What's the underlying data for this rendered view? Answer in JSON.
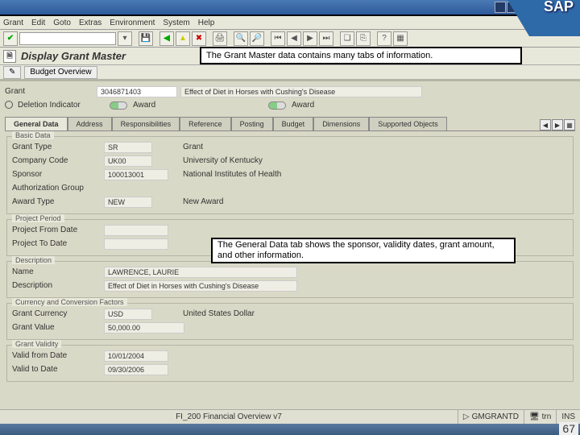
{
  "menubar": [
    "Grant",
    "Edit",
    "Goto",
    "Extras",
    "Environment",
    "System",
    "Help"
  ],
  "header": {
    "title": "Display Grant Master",
    "app_button": "Budget Overview"
  },
  "callouts": {
    "top": "The Grant Master data contains many tabs of information.",
    "mid": "The General Data tab shows the sponsor, validity dates, grant amount, and other information."
  },
  "grant_line": {
    "grant_label": "Grant",
    "grant_value": "3046871403",
    "grant_name": "Effect of Diet in Horses with Cushing's Disease"
  },
  "indicators": {
    "del_label": "Deletion Indicator",
    "award1": "Award",
    "award2": "Award"
  },
  "tabs": [
    "General Data",
    "Address",
    "Responsibilities",
    "Reference",
    "Posting",
    "Budget",
    "Dimensions",
    "Supported Objects"
  ],
  "basic": {
    "title": "Basic Data",
    "grant_type_l": "Grant Type",
    "grant_type_v": "SR",
    "grant_type_t": "Grant",
    "company_l": "Company Code",
    "company_v": "UK00",
    "company_t": "University of Kentucky",
    "sponsor_l": "Sponsor",
    "sponsor_v": "100013001",
    "sponsor_t": "National Institutes of Health",
    "authgrp_l": "Authorization Group",
    "award_l": "Award Type",
    "award_v": "NEW",
    "award_t": "New Award"
  },
  "period": {
    "title": "Project Period",
    "from_l": "Project From Date",
    "to_l": "Project To Date"
  },
  "desc": {
    "title": "Description",
    "name_l": "Name",
    "name_v": "LAWRENCE, LAURIE",
    "desc_l": "Description",
    "desc_v": "Effect of Diet in Horses with Cushing's Disease"
  },
  "curr": {
    "title": "Currency and Conversion Factors",
    "cur_l": "Grant Currency",
    "cur_v": "USD",
    "cur_t": "United States Dollar",
    "val_l": "Grant Value",
    "val_v": "50,000.00"
  },
  "validity": {
    "title": "Grant Validity",
    "from_l": "Valid from Date",
    "from_v": "10/01/2004",
    "to_l": "Valid to Date",
    "to_v": "09/30/2006"
  },
  "footer": {
    "center": "FI_200 Financial Overview v7",
    "tcode": "GMGRANTD",
    "client": "trn",
    "mode": "INS"
  },
  "slide": "67",
  "sap": "SAP"
}
